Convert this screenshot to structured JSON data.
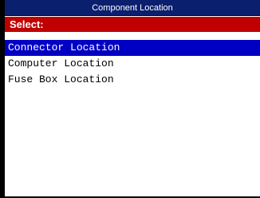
{
  "window": {
    "title": "Component Location"
  },
  "header": {
    "label": "Select:"
  },
  "list": {
    "items": [
      {
        "label": "Connector Location",
        "selected": true
      },
      {
        "label": "Computer Location",
        "selected": false
      },
      {
        "label": "Fuse Box Location",
        "selected": false
      }
    ]
  },
  "colors": {
    "titlebar": "#0a1f6e",
    "header": "#c00000",
    "selection": "#0000c4"
  }
}
